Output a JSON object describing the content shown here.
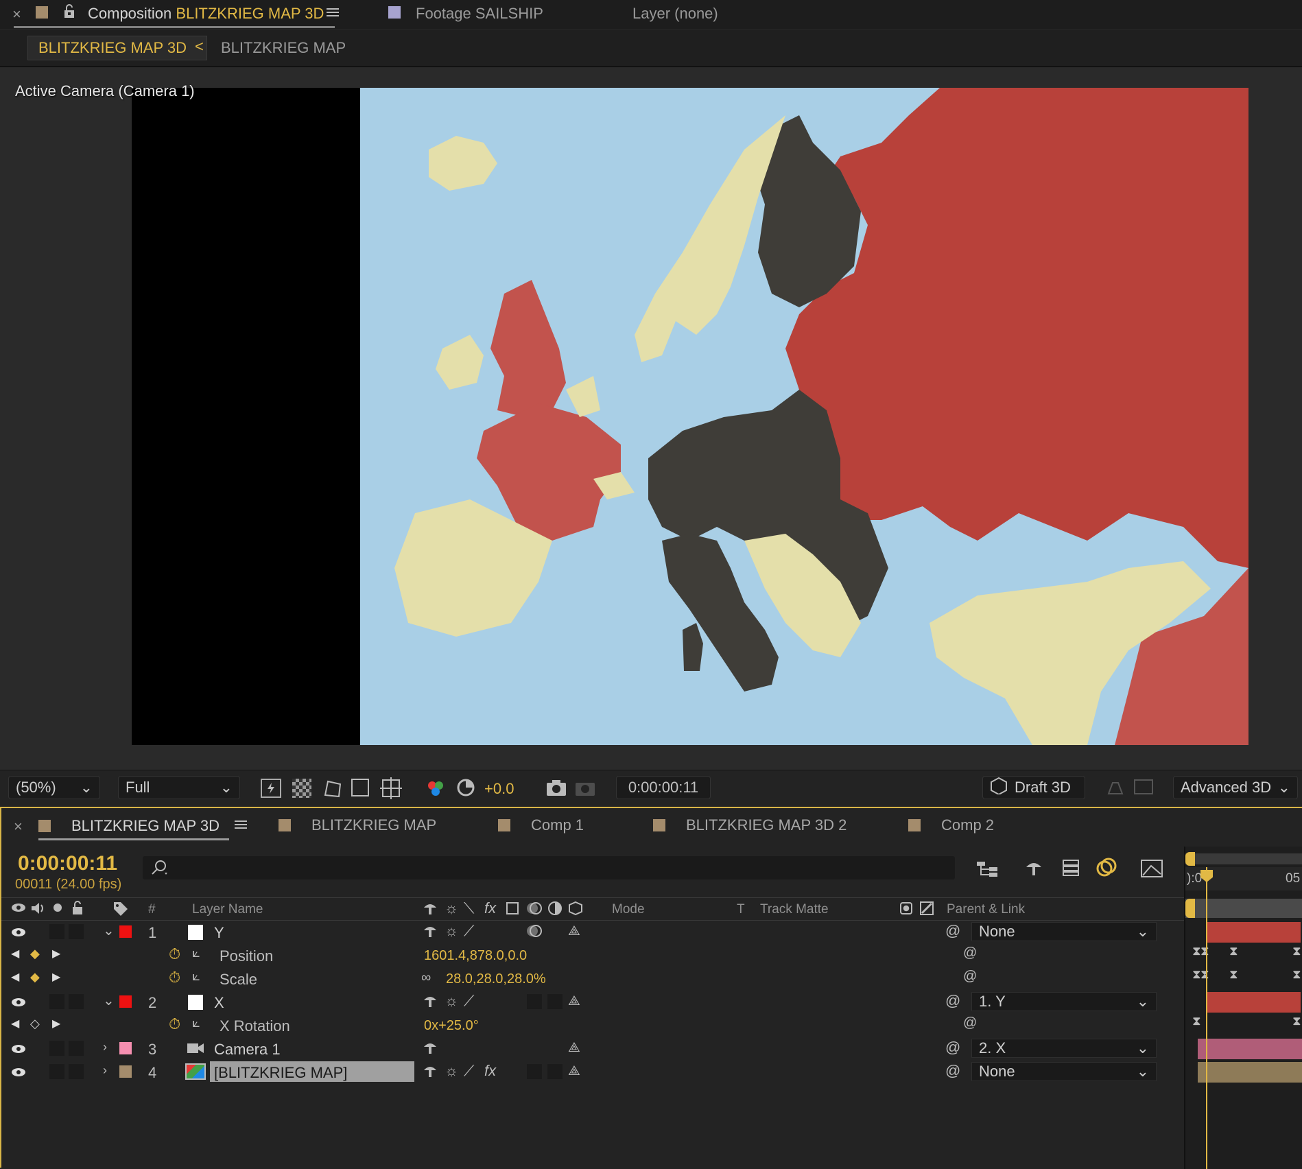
{
  "top_tabs": {
    "comp_prefix": "Composition",
    "comp_name": "BLITZKRIEG MAP 3D",
    "footage_tab": "Footage SAILSHIP",
    "layer_tab": "Layer (none)"
  },
  "breadcrumb": {
    "active": "BLITZKRIEG MAP 3D",
    "separator": "<",
    "parent": "BLITZKRIEG MAP"
  },
  "viewer": {
    "camera_label": "Active Camera (Camera 1)"
  },
  "viewer_toolbar": {
    "zoom": "(50%)",
    "resolution": "Full",
    "exposure": "+0.0",
    "timecode": "0:00:00:11",
    "draft": "Draft 3D",
    "renderer": "Advanced 3D"
  },
  "timeline_tabs": [
    "BLITZKRIEG MAP 3D",
    "BLITZKRIEG MAP",
    "Comp 1",
    "BLITZKRIEG MAP 3D 2",
    "Comp 2"
  ],
  "timeline": {
    "timecode": "0:00:00:11",
    "frames": "00011 (24.00 fps)",
    "search_placeholder": "",
    "ruler_start": "):0",
    "ruler_end": "05"
  },
  "columns": {
    "num": "#",
    "layer_name": "Layer Name",
    "mode": "Mode",
    "t": "T",
    "track_matte": "Track Matte",
    "parent": "Parent & Link"
  },
  "layers": {
    "y": {
      "num": "1",
      "name": "Y",
      "color": "#ee1111",
      "parent": "None"
    },
    "y_position": {
      "label": "Position",
      "value": "1601.4,878.0,0.0"
    },
    "y_scale": {
      "label": "Scale",
      "value": "28.0,28.0,28.0%"
    },
    "x": {
      "num": "2",
      "name": "X",
      "color": "#ee1111",
      "parent": "1. Y"
    },
    "x_rotation": {
      "label": "X Rotation",
      "value": "0x+25.0°"
    },
    "camera": {
      "num": "3",
      "name": "Camera 1",
      "color": "#f58fb0",
      "parent": "2. X"
    },
    "map": {
      "num": "4",
      "name": "[BLITZKRIEG MAP]",
      "color": "#a48c6c",
      "parent": "None"
    }
  },
  "colors": {
    "accent": "#e2b945",
    "sea": "#a9cfe6",
    "axis": "#3f3d38",
    "allies": "#c2534d",
    "ussr": "#b8413a",
    "neutral": "#e4dfaa"
  }
}
